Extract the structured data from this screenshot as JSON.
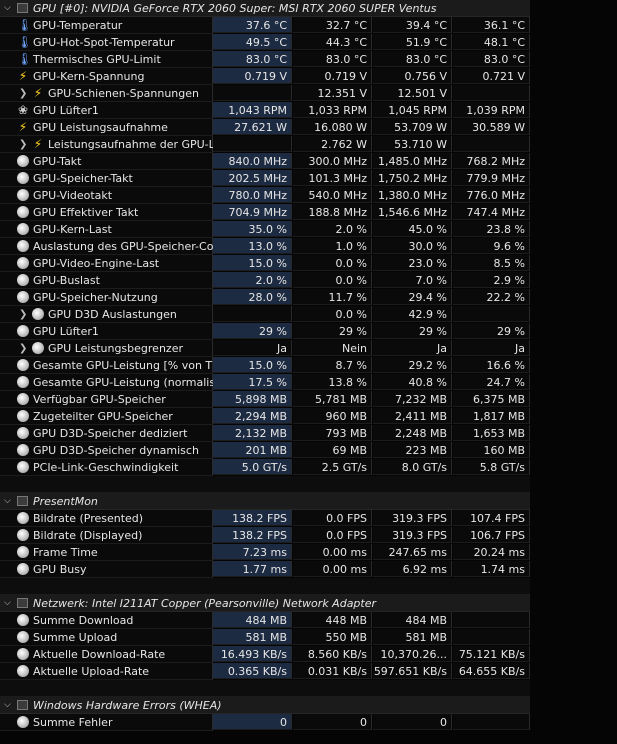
{
  "colors": {
    "background": "#050505",
    "current_column": "#1d2b42",
    "header_bar": "#1b1b1b",
    "bolt": "#ffd21f",
    "thermometer": "#6ea8ff"
  },
  "sections": [
    {
      "title": "GPU [#0]: NVIDIA GeForce RTX 2060 Super: MSI RTX 2060 SUPER Ventus",
      "rows": [
        {
          "icon": "thermometer-icon",
          "label": "GPU-Temperatur",
          "cur": "37.6 °C",
          "min": "32.7 °C",
          "max": "39.4 °C",
          "avg": "36.1 °C"
        },
        {
          "icon": "thermometer-icon",
          "label": "GPU-Hot-Spot-Temperatur",
          "cur": "49.5 °C",
          "min": "44.3 °C",
          "max": "51.9 °C",
          "avg": "48.1 °C"
        },
        {
          "icon": "thermometer-icon",
          "label": "Thermisches GPU-Limit",
          "cur": "83.0 °C",
          "min": "83.0 °C",
          "max": "83.0 °C",
          "avg": "83.0 °C"
        },
        {
          "icon": "bolt-icon",
          "label": "GPU-Kern-Spannung",
          "cur": "0.719 V",
          "min": "0.719 V",
          "max": "0.756 V",
          "avg": "0.721 V"
        },
        {
          "icon": "bolt-icon",
          "label": "GPU-Schienen-Spannungen",
          "cur": "",
          "min": "12.351 V",
          "max": "12.501 V",
          "avg": "",
          "sub": true
        },
        {
          "icon": "fan-icon",
          "label": "GPU Lüfter1",
          "cur": "1,043 RPM",
          "min": "1,033 RPM",
          "max": "1,045 RPM",
          "avg": "1,039 RPM"
        },
        {
          "icon": "bolt-icon",
          "label": "GPU Leistungsaufnahme",
          "cur": "27.621 W",
          "min": "16.080 W",
          "max": "53.709 W",
          "avg": "30.589 W"
        },
        {
          "icon": "bolt-icon",
          "label": "Leistungsaufnahme der GPU-L...",
          "cur": "",
          "min": "2.762 W",
          "max": "53.710 W",
          "avg": "",
          "sub": true
        },
        {
          "icon": "gauge-icon",
          "label": "GPU-Takt",
          "cur": "840.0 MHz",
          "min": "300.0 MHz",
          "max": "1,485.0 MHz",
          "avg": "768.2 MHz"
        },
        {
          "icon": "gauge-icon",
          "label": "GPU-Speicher-Takt",
          "cur": "202.5 MHz",
          "min": "101.3 MHz",
          "max": "1,750.2 MHz",
          "avg": "779.9 MHz"
        },
        {
          "icon": "gauge-icon",
          "label": "GPU-Videotakt",
          "cur": "780.0 MHz",
          "min": "540.0 MHz",
          "max": "1,380.0 MHz",
          "avg": "776.0 MHz"
        },
        {
          "icon": "gauge-icon",
          "label": "GPU Effektiver Takt",
          "cur": "704.9 MHz",
          "min": "188.8 MHz",
          "max": "1,546.6 MHz",
          "avg": "747.4 MHz"
        },
        {
          "icon": "gauge-icon",
          "label": "GPU-Kern-Last",
          "cur": "35.0 %",
          "min": "2.0 %",
          "max": "45.0 %",
          "avg": "23.8 %"
        },
        {
          "icon": "gauge-icon",
          "label": "Auslastung des GPU-Speicher-Con...",
          "cur": "13.0 %",
          "min": "1.0 %",
          "max": "30.0 %",
          "avg": "9.6 %"
        },
        {
          "icon": "gauge-icon",
          "label": "GPU-Video-Engine-Last",
          "cur": "15.0 %",
          "min": "0.0 %",
          "max": "23.0 %",
          "avg": "8.5 %"
        },
        {
          "icon": "gauge-icon",
          "label": "GPU-Buslast",
          "cur": "2.0 %",
          "min": "0.0 %",
          "max": "7.0 %",
          "avg": "2.9 %"
        },
        {
          "icon": "gauge-icon",
          "label": "GPU-Speicher-Nutzung",
          "cur": "28.0 %",
          "min": "11.7 %",
          "max": "29.4 %",
          "avg": "22.2 %"
        },
        {
          "icon": "gauge-icon",
          "label": "GPU D3D Auslastungen",
          "cur": "",
          "min": "0.0 %",
          "max": "42.9 %",
          "avg": "",
          "sub": true
        },
        {
          "icon": "gauge-icon",
          "label": "GPU Lüfter1",
          "cur": "29 %",
          "min": "29 %",
          "max": "29 %",
          "avg": "29 %"
        },
        {
          "icon": "gauge-icon",
          "label": "GPU Leistungsbegrenzer",
          "cur": "Ja",
          "min": "Nein",
          "max": "Ja",
          "avg": "Ja",
          "sub": true
        },
        {
          "icon": "gauge-icon",
          "label": "Gesamte GPU-Leistung [% von TDP]",
          "cur": "15.0 %",
          "min": "8.7 %",
          "max": "29.2 %",
          "avg": "16.6 %"
        },
        {
          "icon": "gauge-icon",
          "label": "Gesamte GPU-Leistung (normalisie...",
          "cur": "17.5 %",
          "min": "13.8 %",
          "max": "40.8 %",
          "avg": "24.7 %"
        },
        {
          "icon": "gauge-icon",
          "label": "Verfügbar GPU-Speicher",
          "cur": "5,898 MB",
          "min": "5,781 MB",
          "max": "7,232 MB",
          "avg": "6,375 MB"
        },
        {
          "icon": "gauge-icon",
          "label": "Zugeteilter GPU-Speicher",
          "cur": "2,294 MB",
          "min": "960 MB",
          "max": "2,411 MB",
          "avg": "1,817 MB"
        },
        {
          "icon": "gauge-icon",
          "label": "GPU D3D-Speicher dediziert",
          "cur": "2,132 MB",
          "min": "793 MB",
          "max": "2,248 MB",
          "avg": "1,653 MB"
        },
        {
          "icon": "gauge-icon",
          "label": "GPU D3D-Speicher dynamisch",
          "cur": "201 MB",
          "min": "69 MB",
          "max": "223 MB",
          "avg": "160 MB"
        },
        {
          "icon": "gauge-icon",
          "label": "PCIe-Link-Geschwindigkeit",
          "cur": "5.0 GT/s",
          "min": "2.5 GT/s",
          "max": "8.0 GT/s",
          "avg": "5.8 GT/s"
        }
      ]
    },
    {
      "title": "PresentMon",
      "rows": [
        {
          "icon": "gauge-icon",
          "label": "Bildrate (Presented)",
          "cur": "138.2 FPS",
          "min": "0.0 FPS",
          "max": "319.3 FPS",
          "avg": "107.4 FPS"
        },
        {
          "icon": "gauge-icon",
          "label": "Bildrate (Displayed)",
          "cur": "138.2 FPS",
          "min": "0.0 FPS",
          "max": "319.3 FPS",
          "avg": "106.7 FPS"
        },
        {
          "icon": "gauge-icon",
          "label": "Frame Time",
          "cur": "7.23 ms",
          "min": "0.00 ms",
          "max": "247.65 ms",
          "avg": "20.24 ms"
        },
        {
          "icon": "gauge-icon",
          "label": "GPU Busy",
          "cur": "1.77 ms",
          "min": "0.00 ms",
          "max": "6.92 ms",
          "avg": "1.74 ms"
        }
      ]
    },
    {
      "title": "Netzwerk: Intel I211AT Copper (Pearsonville) Network Adapter",
      "rows": [
        {
          "icon": "gauge-icon",
          "label": "Summe Download",
          "cur": "484 MB",
          "min": "448 MB",
          "max": "484 MB",
          "avg": ""
        },
        {
          "icon": "gauge-icon",
          "label": "Summe Upload",
          "cur": "581 MB",
          "min": "550 MB",
          "max": "581 MB",
          "avg": ""
        },
        {
          "icon": "gauge-icon",
          "label": "Aktuelle Download-Rate",
          "cur": "16.493 KB/s",
          "min": "8.560 KB/s",
          "max": "10,370.26...",
          "avg": "75.121 KB/s"
        },
        {
          "icon": "gauge-icon",
          "label": "Aktuelle Upload-Rate",
          "cur": "0.365 KB/s",
          "min": "0.031 KB/s",
          "max": "597.651 KB/s",
          "avg": "64.655 KB/s"
        }
      ]
    },
    {
      "title": "Windows Hardware Errors (WHEA)",
      "rows": [
        {
          "icon": "gauge-icon",
          "label": "Summe Fehler",
          "cur": "0",
          "min": "0",
          "max": "0",
          "avg": ""
        }
      ]
    }
  ]
}
